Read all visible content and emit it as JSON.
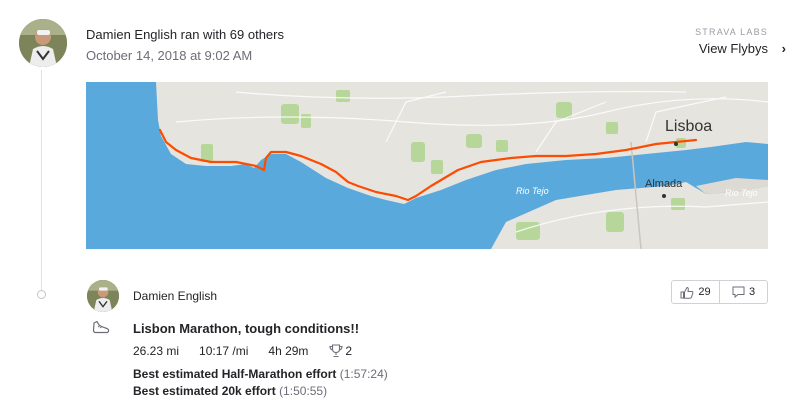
{
  "group": {
    "title": "Damien English ran with 69 others",
    "date": "October 14, 2018 at 9:02 AM",
    "labs_label": "STRAVA LABS",
    "flyby_label": "View Flybys",
    "flyby_chevron": "›"
  },
  "map": {
    "city_label": "Lisboa",
    "town_label": "Almada",
    "river_labels": [
      "Rio Tejo",
      "Rio Tejo"
    ],
    "colors": {
      "water": "#5aa9dc",
      "land": "#e6e4de",
      "park": "#b7d69a",
      "route": "#fc4c02"
    }
  },
  "activity": {
    "athlete_name": "Damien English",
    "title": "Lisbon Marathon, tough conditions!!",
    "sport_icon": "run-shoe-icon",
    "stats": {
      "distance": "26.23 mi",
      "pace": "10:17 /mi",
      "time": "4h 29m",
      "achievements": "2"
    },
    "efforts": [
      {
        "label": "Best estimated Half-Marathon effort",
        "time": "(1:57:24)"
      },
      {
        "label": "Best estimated 20k effort",
        "time": "(1:50:55)"
      }
    ],
    "kudos_count": "29",
    "comment_count": "3"
  }
}
